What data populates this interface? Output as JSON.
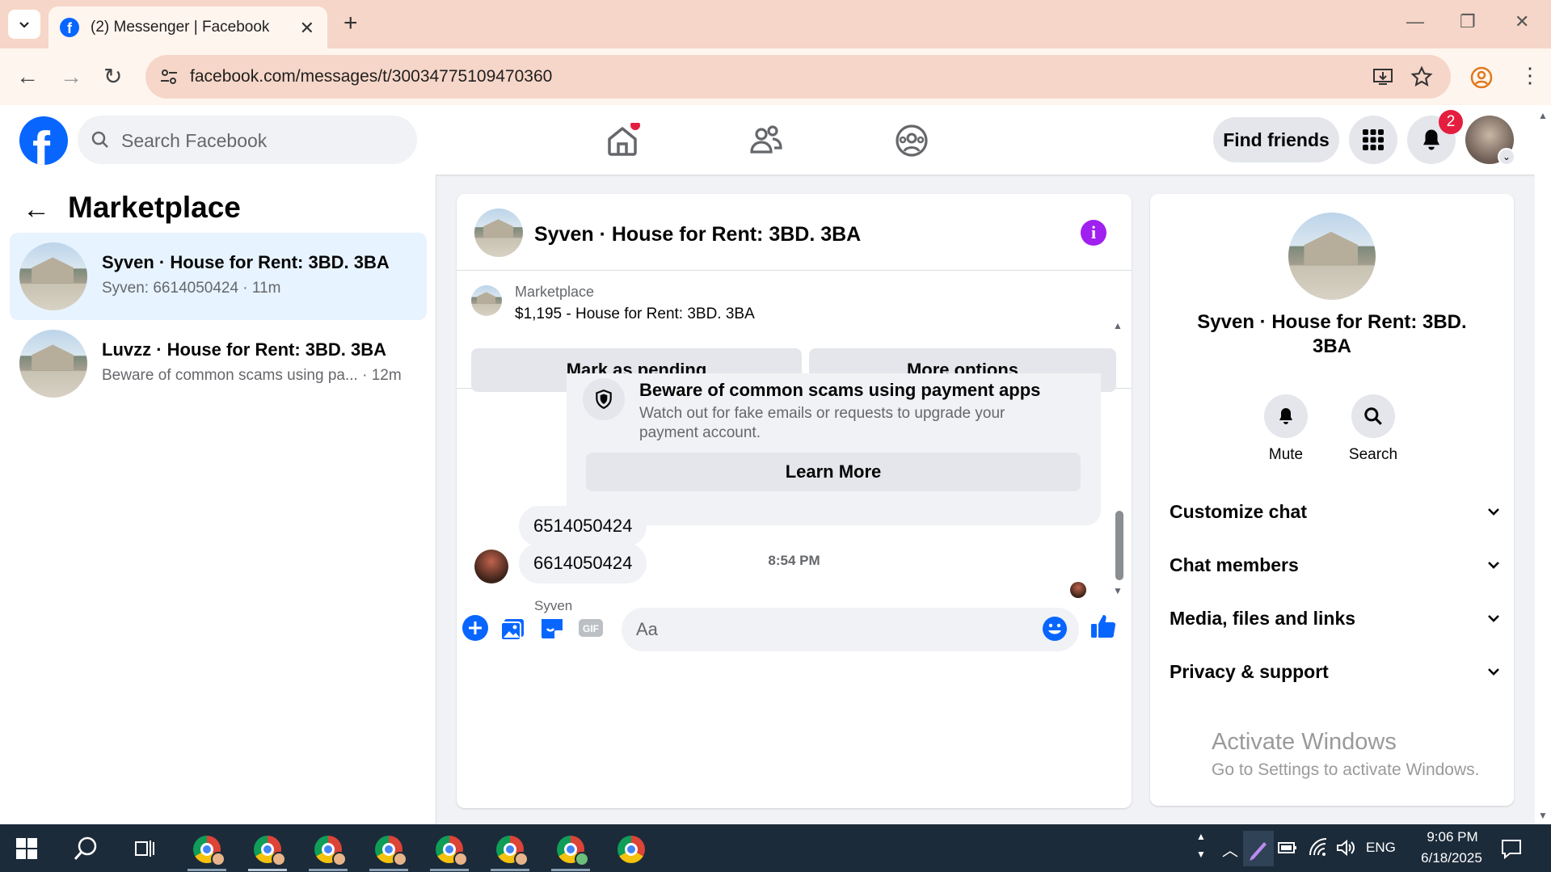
{
  "browser": {
    "tab_title": "(2) Messenger | Facebook",
    "url": "facebook.com/messages/t/30034775109470360"
  },
  "fb": {
    "search_placeholder": "Search Facebook",
    "find_friends": "Find friends",
    "notifications_count": "2"
  },
  "left": {
    "title": "Marketplace",
    "conversations": [
      {
        "title": "Syven · House for Rent: 3BD. 3BA",
        "subtitle": "Syven: 6614050424 · 11m",
        "active": true
      },
      {
        "title": "Luvzz · House for Rent: 3BD. 3BA",
        "subtitle": "Beware of common scams using pa... · 12m",
        "active": false
      }
    ]
  },
  "chat": {
    "title": "Syven · House for Rent: 3BD. 3BA",
    "listing_category": "Marketplace",
    "listing_price": "$1,195 - House for Rent: 3BD. 3BA",
    "mark_pending": "Mark as pending",
    "more_options": "More options",
    "scam_title": "Beware of common scams using payment apps",
    "scam_body": "Watch out for fake emails or requests to upgrade your payment account.",
    "learn_more": "Learn More",
    "time": "8:54 PM",
    "sender": "Syven",
    "messages": [
      "6514050424",
      "6614050424"
    ],
    "input_placeholder": "Aa"
  },
  "right": {
    "title": "Syven · House for Rent: 3BD. 3BA",
    "mute": "Mute",
    "search": "Search",
    "sections": [
      "Customize chat",
      "Chat members",
      "Media, files and links",
      "Privacy & support"
    ]
  },
  "watermark": {
    "title": "Activate Windows",
    "subtitle": "Go to Settings to activate Windows."
  },
  "taskbar": {
    "lang": "ENG",
    "time": "9:06 PM",
    "date": "6/18/2025"
  },
  "colors": {
    "fb_blue": "#0866ff",
    "messenger_purple": "#a020f0",
    "badge_red": "#e41e3f"
  }
}
